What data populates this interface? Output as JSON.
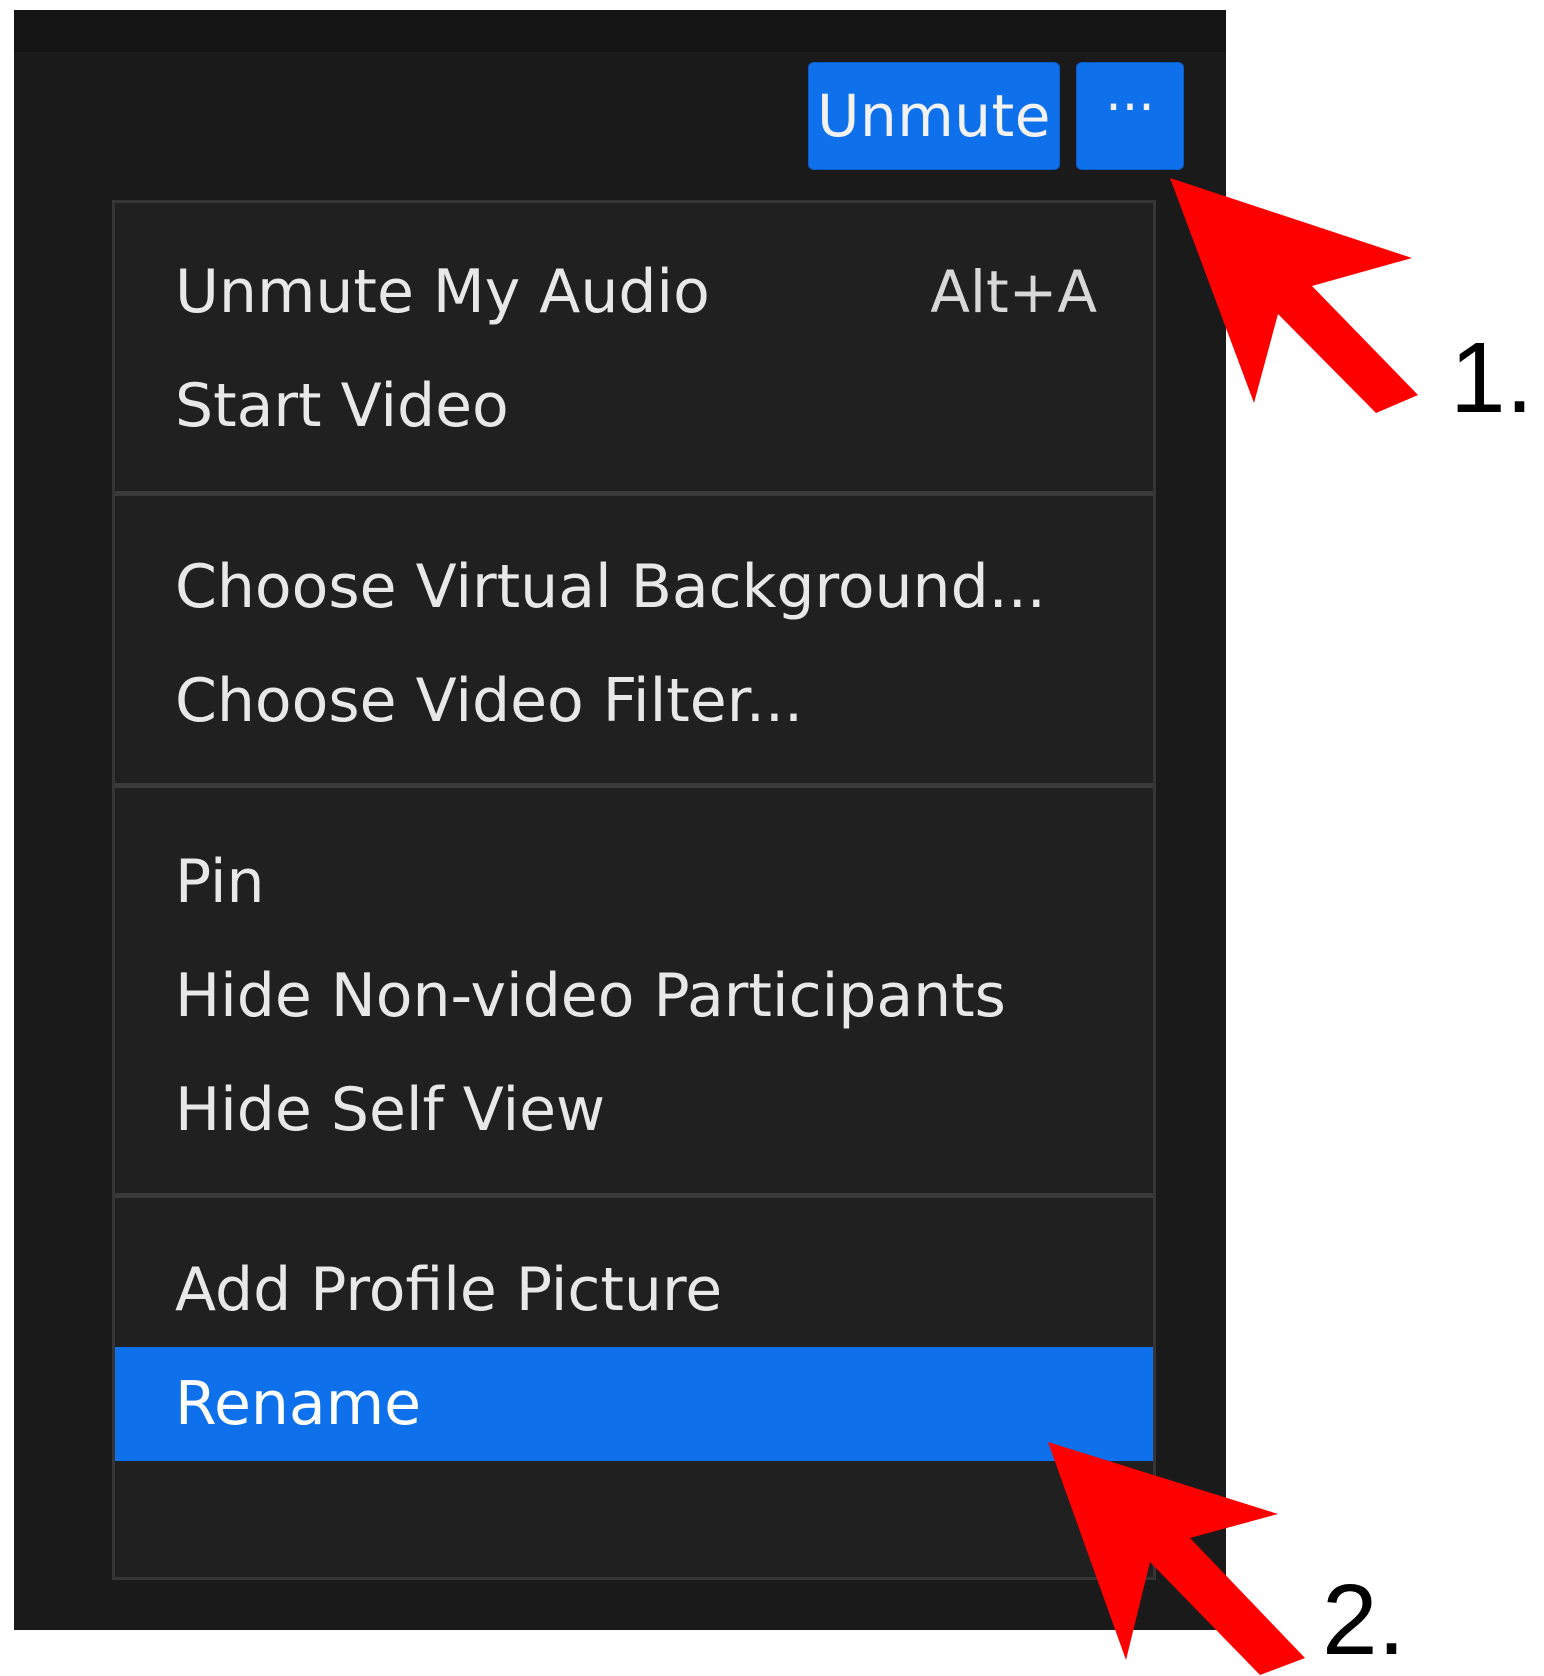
{
  "toolbar": {
    "unmute_label": "Unmute",
    "more_label": "···"
  },
  "menu": {
    "items": [
      {
        "label": "Unmute My Audio",
        "shortcut": "Alt+A"
      },
      {
        "label": "Start Video"
      },
      {
        "label": "Choose Virtual Background..."
      },
      {
        "label": "Choose Video Filter..."
      },
      {
        "label": "Pin"
      },
      {
        "label": "Hide Non-video Participants"
      },
      {
        "label": "Hide Self View"
      },
      {
        "label": "Add Profile Picture"
      },
      {
        "label": "Rename",
        "highlighted": true
      }
    ]
  },
  "annotations": {
    "step1": "1.",
    "step2": "2.",
    "arrow_color": "#ff0000",
    "arrow_icon": "red-arrow-icon"
  },
  "colors": {
    "accent": "#0e71eb",
    "window_bg": "#1a1a1a",
    "menu_bg": "#202020",
    "text": "#e8e8e8"
  }
}
